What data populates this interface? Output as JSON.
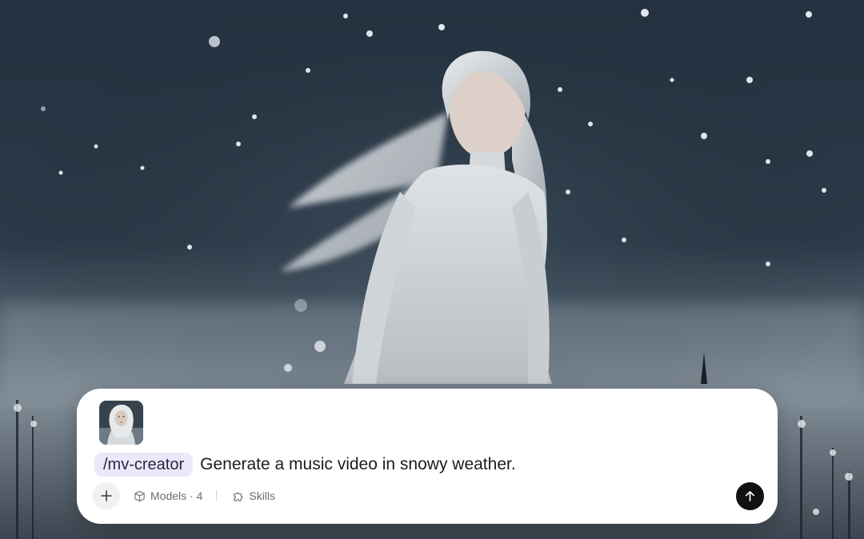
{
  "background": {
    "description_icon": "snow-portrait-photo",
    "sky_color": "#263340",
    "fog_color": "#8a97a3"
  },
  "composer": {
    "attachment": {
      "icon": "portrait-thumbnail"
    },
    "skill_command": "/mv-creator",
    "prompt_text": "Generate a music video in snowy weather.",
    "toolbar": {
      "add_icon": "plus-icon",
      "models_label": "Models · 4",
      "skills_label": "Skills"
    },
    "send_icon": "arrow-up-icon"
  },
  "colors": {
    "chip_bg": "#ece8fb",
    "send_bg": "#111111",
    "muted_text": "#6e6e73"
  }
}
